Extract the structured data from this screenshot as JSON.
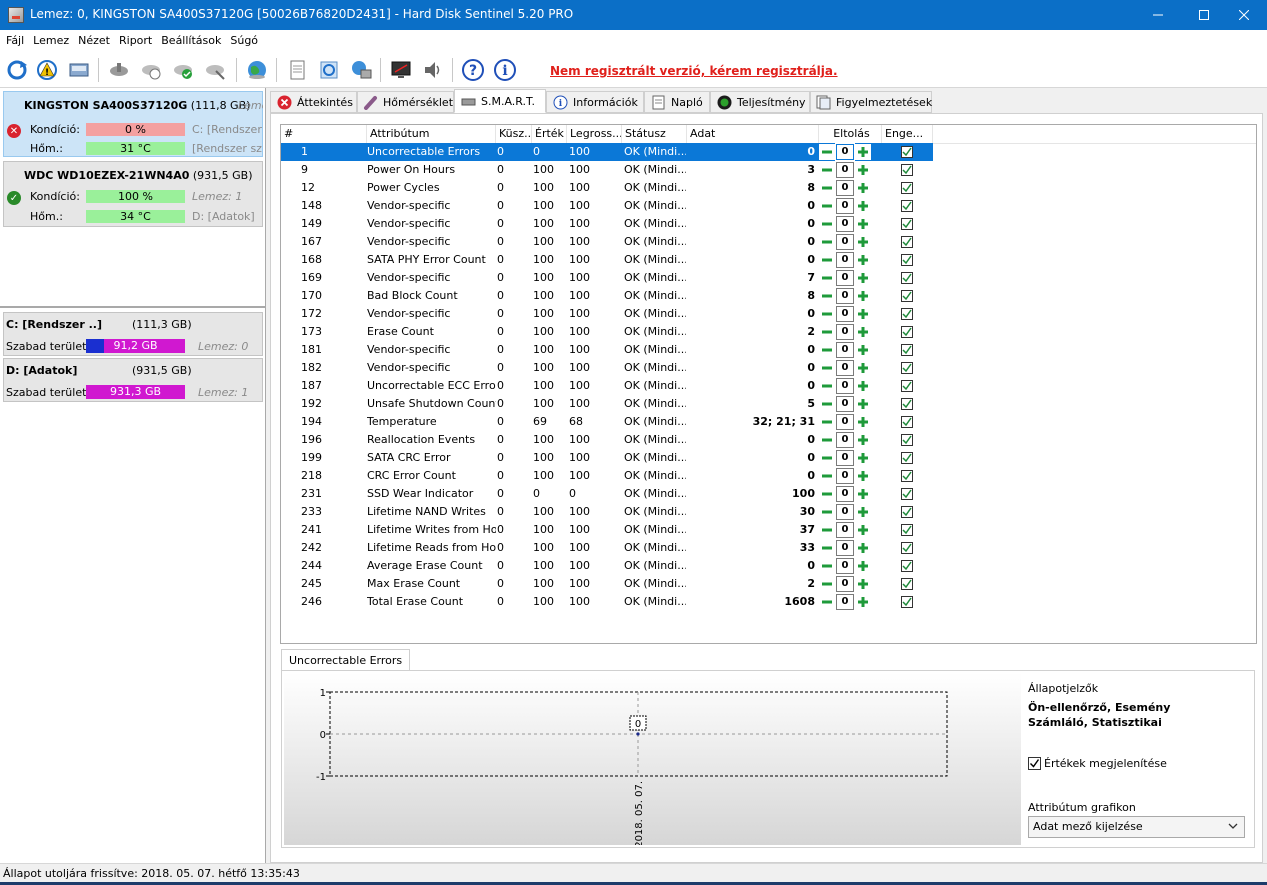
{
  "window": {
    "title": "Lemez: 0, KINGSTON SA400S37120G [50026B76820D2431]  -  Hard Disk Sentinel 5.20 PRO"
  },
  "menu": [
    "Fájl",
    "Lemez",
    "Nézet",
    "Riport",
    "Beállítások",
    "Súgó"
  ],
  "toolbar": {
    "register_link": "Nem regisztrált verzió, kérem regisztrálja."
  },
  "disks": [
    {
      "model": "KINGSTON SA400S37120G",
      "size": "(111,8 GB)",
      "side_top": "Leme",
      "condition_label": "Kondíció:",
      "condition": "0 %",
      "condition_pct": 0,
      "condition_side": "C: [Rendszer S",
      "temp_label": "Hőm.:",
      "temp": "31 °C",
      "temp_side": "[Rendszer szá",
      "status": "bad"
    },
    {
      "model": "WDC WD10EZEX-21WN4A0",
      "size": "(931,5 GB)",
      "side_top": "",
      "condition_label": "Kondíció:",
      "condition": "100 %",
      "condition_pct": 100,
      "condition_side": "Lemez: 1",
      "temp_label": "Hőm.:",
      "temp": "34 °C",
      "temp_side": "D: [Adatok]",
      "status": "good"
    }
  ],
  "volumes": [
    {
      "name": "C: [Rendszer ..]",
      "size": "(111,3 GB)",
      "free_label": "Szabad terület",
      "free": "91,2 GB",
      "used_fraction": 0.18,
      "disk": "Lemez: 0"
    },
    {
      "name": "D: [Adatok]",
      "size": "(931,5 GB)",
      "free_label": "Szabad terület",
      "free": "931,3 GB",
      "used_fraction": 0.0,
      "disk": "Lemez: 1"
    }
  ],
  "tabs": [
    {
      "label": "Áttekintés",
      "icon": "error-icon"
    },
    {
      "label": "Hőmérséklet",
      "icon": "thermometer-icon"
    },
    {
      "label": "S.M.A.R.T.",
      "icon": "disk-icon",
      "active": true
    },
    {
      "label": "Információk",
      "icon": "info-icon"
    },
    {
      "label": "Napló",
      "icon": "log-icon"
    },
    {
      "label": "Teljesítmény",
      "icon": "performance-icon"
    },
    {
      "label": "Figyelmeztetések",
      "icon": "alerts-icon"
    }
  ],
  "smart": {
    "columns": [
      "#",
      "Attribútum",
      "Küsz...",
      "Érték",
      "Legross...",
      "Státusz",
      "Adat",
      "Eltolás",
      "Enge..."
    ],
    "rows": [
      {
        "id": "1",
        "name": "Uncorrectable Errors",
        "thr": "0",
        "val": "0",
        "worst": "100",
        "status": "OK (Mindi...",
        "data": "0",
        "offset": "0"
      },
      {
        "id": "9",
        "name": "Power On Hours",
        "thr": "0",
        "val": "100",
        "worst": "100",
        "status": "OK (Mindi...",
        "data": "3",
        "offset": "0"
      },
      {
        "id": "12",
        "name": "Power Cycles",
        "thr": "0",
        "val": "100",
        "worst": "100",
        "status": "OK (Mindi...",
        "data": "8",
        "offset": "0"
      },
      {
        "id": "148",
        "name": "Vendor-specific",
        "thr": "0",
        "val": "100",
        "worst": "100",
        "status": "OK (Mindi...",
        "data": "0",
        "offset": "0"
      },
      {
        "id": "149",
        "name": "Vendor-specific",
        "thr": "0",
        "val": "100",
        "worst": "100",
        "status": "OK (Mindi...",
        "data": "0",
        "offset": "0"
      },
      {
        "id": "167",
        "name": "Vendor-specific",
        "thr": "0",
        "val": "100",
        "worst": "100",
        "status": "OK (Mindi...",
        "data": "0",
        "offset": "0"
      },
      {
        "id": "168",
        "name": "SATA PHY Error Count",
        "thr": "0",
        "val": "100",
        "worst": "100",
        "status": "OK (Mindi...",
        "data": "0",
        "offset": "0"
      },
      {
        "id": "169",
        "name": "Vendor-specific",
        "thr": "0",
        "val": "100",
        "worst": "100",
        "status": "OK (Mindi...",
        "data": "7",
        "offset": "0"
      },
      {
        "id": "170",
        "name": "Bad Block Count",
        "thr": "0",
        "val": "100",
        "worst": "100",
        "status": "OK (Mindi...",
        "data": "8",
        "offset": "0"
      },
      {
        "id": "172",
        "name": "Vendor-specific",
        "thr": "0",
        "val": "100",
        "worst": "100",
        "status": "OK (Mindi...",
        "data": "0",
        "offset": "0"
      },
      {
        "id": "173",
        "name": "Erase Count",
        "thr": "0",
        "val": "100",
        "worst": "100",
        "status": "OK (Mindi...",
        "data": "2",
        "offset": "0"
      },
      {
        "id": "181",
        "name": "Vendor-specific",
        "thr": "0",
        "val": "100",
        "worst": "100",
        "status": "OK (Mindi...",
        "data": "0",
        "offset": "0"
      },
      {
        "id": "182",
        "name": "Vendor-specific",
        "thr": "0",
        "val": "100",
        "worst": "100",
        "status": "OK (Mindi...",
        "data": "0",
        "offset": "0"
      },
      {
        "id": "187",
        "name": "Uncorrectable ECC Errors",
        "thr": "0",
        "val": "100",
        "worst": "100",
        "status": "OK (Mindi...",
        "data": "0",
        "offset": "0"
      },
      {
        "id": "192",
        "name": "Unsafe Shutdown Count",
        "thr": "0",
        "val": "100",
        "worst": "100",
        "status": "OK (Mindi...",
        "data": "5",
        "offset": "0"
      },
      {
        "id": "194",
        "name": "Temperature",
        "thr": "0",
        "val": "69",
        "worst": "68",
        "status": "OK (Mindi...",
        "data": "32; 21; 31",
        "offset": "0"
      },
      {
        "id": "196",
        "name": "Reallocation Events",
        "thr": "0",
        "val": "100",
        "worst": "100",
        "status": "OK (Mindi...",
        "data": "0",
        "offset": "0"
      },
      {
        "id": "199",
        "name": "SATA CRC Error",
        "thr": "0",
        "val": "100",
        "worst": "100",
        "status": "OK (Mindi...",
        "data": "0",
        "offset": "0"
      },
      {
        "id": "218",
        "name": "CRC Error Count",
        "thr": "0",
        "val": "100",
        "worst": "100",
        "status": "OK (Mindi...",
        "data": "0",
        "offset": "0"
      },
      {
        "id": "231",
        "name": "SSD Wear Indicator",
        "thr": "0",
        "val": "0",
        "worst": "0",
        "status": "OK (Mindi...",
        "data": "100",
        "offset": "0"
      },
      {
        "id": "233",
        "name": "Lifetime NAND Writes",
        "thr": "0",
        "val": "100",
        "worst": "100",
        "status": "OK (Mindi...",
        "data": "30",
        "offset": "0"
      },
      {
        "id": "241",
        "name": "Lifetime Writes from Ho...",
        "thr": "0",
        "val": "100",
        "worst": "100",
        "status": "OK (Mindi...",
        "data": "37",
        "offset": "0"
      },
      {
        "id": "242",
        "name": "Lifetime Reads from Ho...",
        "thr": "0",
        "val": "100",
        "worst": "100",
        "status": "OK (Mindi...",
        "data": "33",
        "offset": "0"
      },
      {
        "id": "244",
        "name": "Average Erase Count",
        "thr": "0",
        "val": "100",
        "worst": "100",
        "status": "OK (Mindi...",
        "data": "0",
        "offset": "0"
      },
      {
        "id": "245",
        "name": "Max Erase Count",
        "thr": "0",
        "val": "100",
        "worst": "100",
        "status": "OK (Mindi...",
        "data": "2",
        "offset": "0"
      },
      {
        "id": "246",
        "name": "Total Erase Count",
        "thr": "0",
        "val": "100",
        "worst": "100",
        "status": "OK (Mindi...",
        "data": "1608",
        "offset": "0"
      }
    ]
  },
  "lower": {
    "tab": "Uncorrectable Errors",
    "chart_data": {
      "type": "line",
      "x": [
        "2018. 05. 07."
      ],
      "series": [
        {
          "values": [
            0
          ]
        }
      ],
      "ylim": [
        -1,
        1
      ],
      "yticks": [
        "1",
        "0",
        "-1"
      ],
      "point_label": "0"
    },
    "status_indicators_label": "Állapotjelzők",
    "status_indicators_value": "Ön-ellenőrző, Esemény Számláló, Statisztikai",
    "show_values_label": "Értékek megjelenítése",
    "show_values_checked": true,
    "attr_graph_label": "Attribútum grafikon",
    "attr_graph_value": "Adat mező kijelzése"
  },
  "statusbar": {
    "text": "Állapot utoljára frissítve: 2018. 05. 07. hétfő 13:35:43"
  }
}
